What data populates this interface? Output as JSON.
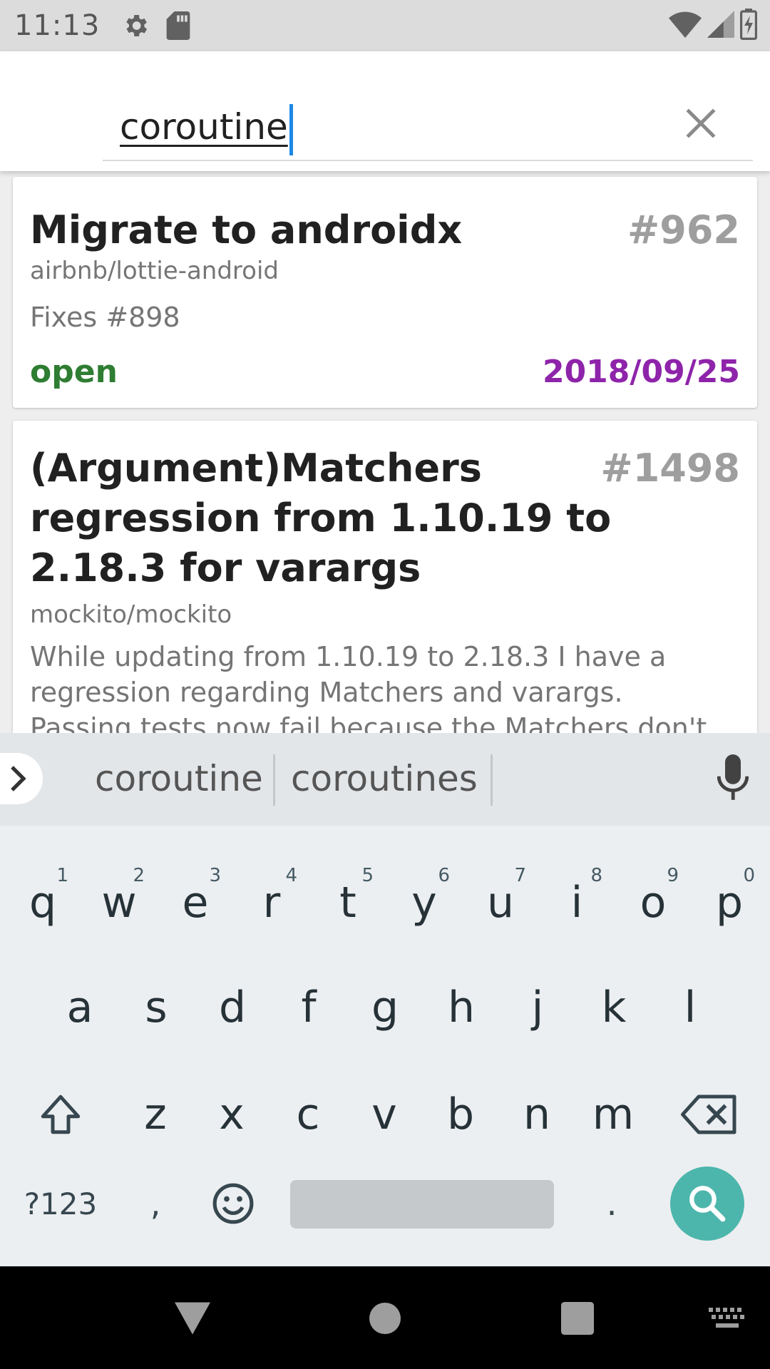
{
  "status_bar": {
    "time": "11:13",
    "icons": [
      "settings-icon",
      "sd-card-icon",
      "wifi-icon",
      "cell-signal-icon",
      "battery-icon"
    ]
  },
  "search": {
    "value": "coroutine",
    "clear_icon": "close-icon"
  },
  "results": [
    {
      "title": "Migrate to androidx",
      "number": "#962",
      "repo": "airbnb/lottie-android",
      "body": "Fixes #898",
      "state": "open",
      "date": "2018/09/25"
    },
    {
      "title_lines": [
        "(Argument)Matchers",
        "regression from 1.10.19 to",
        "2.18.3 for varargs"
      ],
      "number": "#1498",
      "repo": "mockito/mockito",
      "body_lines": [
        "While updating from 1.10.19 to 2.18.3 I have a",
        "regression regarding Matchers and varargs.",
        "Passing tests now fail because the Matchers don't"
      ]
    }
  ],
  "keyboard": {
    "suggestions": [
      "coroutine",
      "coroutines"
    ],
    "row1": [
      {
        "key": "q",
        "hint": "1"
      },
      {
        "key": "w",
        "hint": "2"
      },
      {
        "key": "e",
        "hint": "3"
      },
      {
        "key": "r",
        "hint": "4"
      },
      {
        "key": "t",
        "hint": "5"
      },
      {
        "key": "y",
        "hint": "6"
      },
      {
        "key": "u",
        "hint": "7"
      },
      {
        "key": "i",
        "hint": "8"
      },
      {
        "key": "o",
        "hint": "9"
      },
      {
        "key": "p",
        "hint": "0"
      }
    ],
    "row2": [
      "a",
      "s",
      "d",
      "f",
      "g",
      "h",
      "j",
      "k",
      "l"
    ],
    "row3": [
      "z",
      "x",
      "c",
      "v",
      "b",
      "n",
      "m"
    ],
    "symbols_label": "?123",
    "comma": ",",
    "period": ".",
    "accent_color": "#4db6ac"
  },
  "colors": {
    "open_state": "#2e7d32",
    "date": "#8e24aa",
    "issue_number": "#9e9e9e"
  }
}
